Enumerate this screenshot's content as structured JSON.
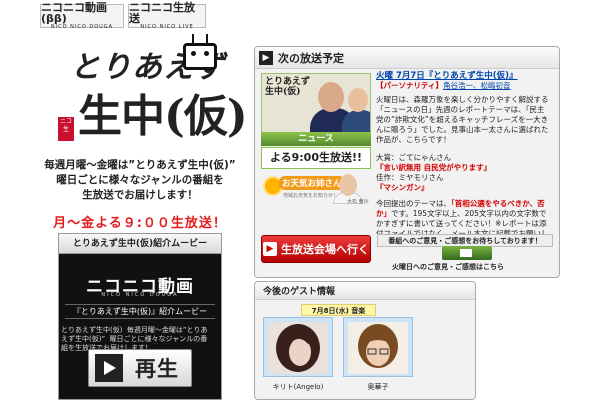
{
  "top_logos": [
    {
      "label": "ニコニコ動画(ββ)",
      "sub": "NICO NICO DOUGA"
    },
    {
      "label": "ニコニコ生放送",
      "sub": "NICO NICO LIVE"
    }
  ],
  "brand": {
    "line1": "とりあえず",
    "line2": "生中(仮)",
    "seal": "ニコ生"
  },
  "description": "毎週月曜〜金曜は”とりあえず生中(仮)”\n曜日ごとに様々なジャンルの番組を\n生放送でお届けします！",
  "slogan": "月〜金よる９:００生放送！",
  "movie": {
    "title": "とりあえず生中(仮)紹介ムービー",
    "logo": "ニコニコ動画",
    "logo_sub": "NICO NICO DOUGA",
    "caption": "『とりあえず生中(仮)』紹介ムービー",
    "text": "とりあえず生中(仮)  毎週月曜〜金曜は”とりあ\nえず生中(仮)”  曜日ごとに様々なジャンルの番\n組を生放送でお届けします！",
    "play_label": "再生"
  },
  "next_broadcast": {
    "heading": "次の放送予定",
    "thumb_brand": "とりあえず\n生中(仮)",
    "news_label": "ニュース",
    "time_label": "よる9:00生放送!!",
    "weather_label": "お天気お姉さん",
    "weather_sub": "地域お天気をお知らせ！",
    "weather_name": "大石 亜沙",
    "date": "火曜 7月7日『とりあえず生中(仮)』",
    "role": "【パーソナリティ】",
    "personality": "角谷浩一、松嶋初音",
    "body1": "火曜日は、森羅万象を楽しく分かりやすく解説する「ニュースの日」先週のレポートテーマは、「民主党の”詐欺文化”を超えるキャッチフレーズを一大きんに贈ろう」でした。見事山本一太さんに選ばれた作品が、こちらです！",
    "winner_prefix": "大賞：ごてにゃんさん",
    "winner_quote": "『言い訳無用  自民党がやります』",
    "runner_prefix": "佳作：ミヤモリさん",
    "runner_quote": "『マシンガン』",
    "body2_prefix": "今回提出のテーマは、",
    "body2_theme": "「首相公選をやるべきか、否か」",
    "body2_rest": "です。195文字以上、205文字以内の文字数でかすぎずに書いて送ってください！※レポートは添付ファイルではなく、メール本文に記載でお願いします。",
    "cta_label": "生放送会場へ行く",
    "opinion_label": "番組へのご意見・ご感想をお待ちしております！",
    "opinion_link": "火曜日へのご意見・ご感想はこちら"
  },
  "guests": {
    "heading": "今後のゲスト情報",
    "date": "7月8日(水) 音楽",
    "items": [
      {
        "name": "キリト(Angelo)",
        "hair": "#3b1f1a",
        "skin": "#e9d3c7"
      },
      {
        "name": "奥華子",
        "hair": "#7a4a22",
        "skin": "#f0cfb5"
      }
    ]
  }
}
